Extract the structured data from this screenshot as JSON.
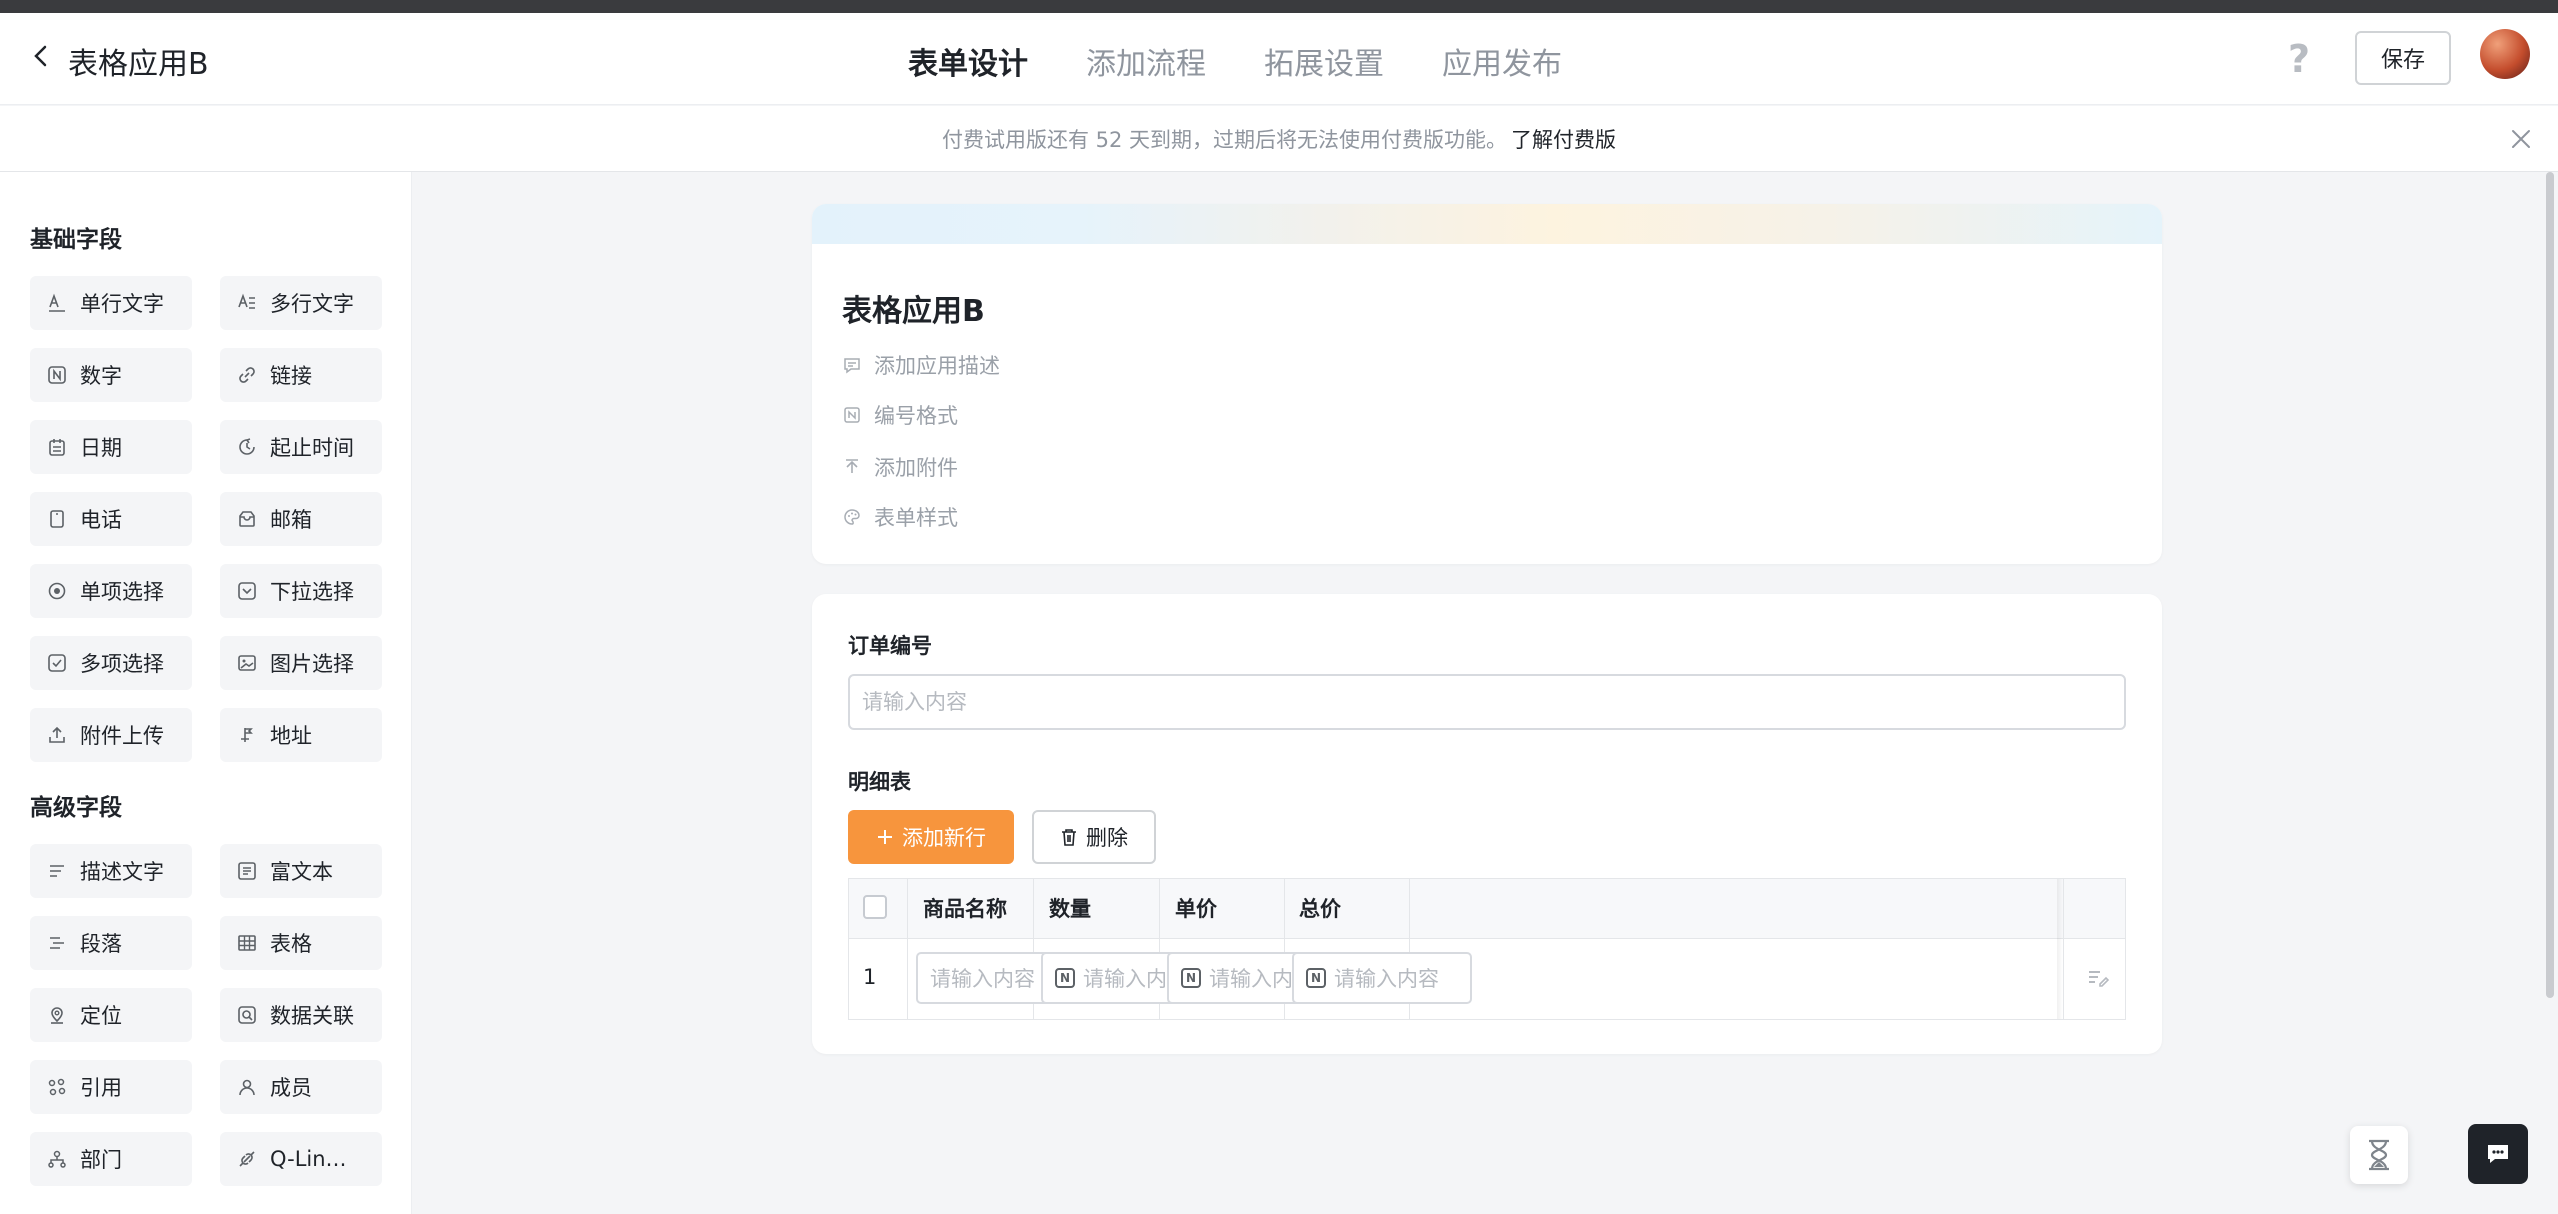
{
  "header": {
    "app_title": "表格应用B",
    "tabs": [
      {
        "label": "表单设计",
        "active": true
      },
      {
        "label": "添加流程",
        "active": false
      },
      {
        "label": "拓展设置",
        "active": false
      },
      {
        "label": "应用发布",
        "active": false
      }
    ],
    "help_label": "?",
    "save_label": "保存"
  },
  "notice": {
    "text": "付费试用版还有 52 天到期，过期后将无法使用付费版功能。",
    "link": "了解付费版"
  },
  "sidebar": {
    "basic_title": "基础字段",
    "basic_fields": [
      {
        "label": "单行文字",
        "icon": "single-line-text-icon"
      },
      {
        "label": "多行文字",
        "icon": "multi-line-text-icon"
      },
      {
        "label": "数字",
        "icon": "number-icon"
      },
      {
        "label": "链接",
        "icon": "link-icon"
      },
      {
        "label": "日期",
        "icon": "date-icon"
      },
      {
        "label": "起止时间",
        "icon": "time-range-icon"
      },
      {
        "label": "电话",
        "icon": "phone-icon"
      },
      {
        "label": "邮箱",
        "icon": "mail-icon"
      },
      {
        "label": "单项选择",
        "icon": "radio-icon"
      },
      {
        "label": "下拉选择",
        "icon": "dropdown-icon"
      },
      {
        "label": "多项选择",
        "icon": "checkbox-icon"
      },
      {
        "label": "图片选择",
        "icon": "image-icon"
      },
      {
        "label": "附件上传",
        "icon": "upload-icon"
      },
      {
        "label": "地址",
        "icon": "address-icon"
      }
    ],
    "advanced_title": "高级字段",
    "advanced_fields": [
      {
        "label": "描述文字",
        "icon": "description-icon"
      },
      {
        "label": "富文本",
        "icon": "rich-text-icon"
      },
      {
        "label": "段落",
        "icon": "paragraph-icon"
      },
      {
        "label": "表格",
        "icon": "table-icon"
      },
      {
        "label": "定位",
        "icon": "location-icon"
      },
      {
        "label": "数据关联",
        "icon": "data-link-icon"
      },
      {
        "label": "引用",
        "icon": "reference-icon"
      },
      {
        "label": "成员",
        "icon": "member-icon"
      },
      {
        "label": "部门",
        "icon": "department-icon"
      },
      {
        "label": "Q-Lin…",
        "icon": "q-link-icon"
      }
    ]
  },
  "form_header": {
    "title": "表格应用B",
    "meta": [
      {
        "label": "添加应用描述",
        "icon": "comment-icon"
      },
      {
        "label": "编号格式",
        "icon": "number-format-icon"
      },
      {
        "label": "添加附件",
        "icon": "attachment-upload-icon"
      },
      {
        "label": "表单样式",
        "icon": "palette-icon"
      }
    ]
  },
  "form_body": {
    "order_label": "订单编号",
    "order_placeholder": "请输入内容",
    "detail_label": "明细表",
    "add_row_label": "添加新行",
    "delete_label": "删除",
    "table": {
      "columns": [
        "商品名称",
        "数量",
        "单价",
        "总价"
      ],
      "rows": [
        {
          "index": "1",
          "placeholders": [
            "请输入内容",
            "请输入内容",
            "请输入内容",
            "请输入内容"
          ]
        }
      ]
    }
  },
  "colors": {
    "accent": "#f7953d",
    "text": "#1f2329",
    "muted": "#8f959e"
  }
}
